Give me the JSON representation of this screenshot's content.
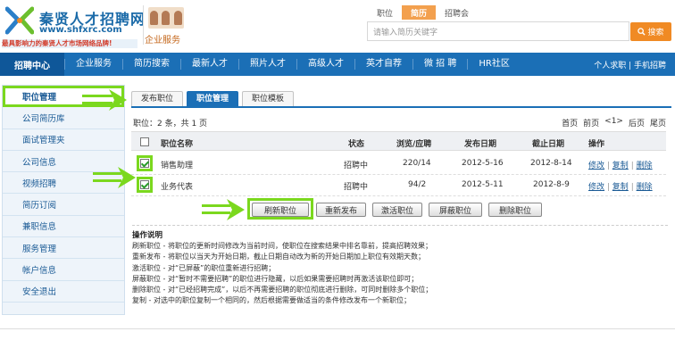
{
  "logo": {
    "title": "秦贤人才招聘网",
    "url": "www.shfxrc.com",
    "slogan": "最具影响力的秦贤人才市场网络品牌!"
  },
  "enterprise": {
    "label": "企业服务"
  },
  "search": {
    "tabs": [
      {
        "label": "职位"
      },
      {
        "label": "简历"
      },
      {
        "label": "招聘会"
      }
    ],
    "active_tab": "简历",
    "placeholder": "请输入简历关键字",
    "button": "搜索"
  },
  "nav": {
    "home": "招聘中心",
    "items": [
      "企业服务",
      "简历搜索",
      "最新人才",
      "照片人才",
      "高级人才",
      "英才自荐",
      "微 招 聘",
      "HR社区"
    ],
    "right": "个人求职 | 手机招聘"
  },
  "sidebar": {
    "items": [
      "职位管理",
      "公司简历库",
      "面试管理夹",
      "公司信息",
      "视频招聘",
      "简历订阅",
      "兼职信息",
      "服务管理",
      "帐户信息",
      "安全退出"
    ],
    "active": "职位管理"
  },
  "tabs": [
    "发布职位",
    "职位管理",
    "职位模板"
  ],
  "active_tab": "职位管理",
  "summary": "职位：2 条，共 1 页",
  "pager": [
    "首页",
    "前页",
    "<1>",
    "后页",
    "尾页"
  ],
  "table": {
    "headers": [
      "职位名称",
      "状态",
      "浏览/应聘",
      "发布日期",
      "截止日期",
      "操作"
    ],
    "rows": [
      {
        "name": "销售助理",
        "status": "招聘中",
        "views": "220/14",
        "publish": "2012-5-16",
        "deadline": "2012-8-14",
        "checked": true
      },
      {
        "name": "业务代表",
        "status": "招聘中",
        "views": "94/2",
        "publish": "2012-5-11",
        "deadline": "2012-8-9",
        "checked": true
      }
    ],
    "actions": [
      "修改",
      "复制",
      "删除"
    ]
  },
  "buttons": [
    "刷新职位",
    "重新发布",
    "激活职位",
    "屏蔽职位",
    "删除职位"
  ],
  "notes": {
    "title": "操作说明",
    "lines": [
      "刷新职位 - 将职位的更新时间修改为当前时间，使职位在搜索结果中排名靠前，提高招聘效果；",
      "重新发布 - 将职位以当天为开始日期，截止日期自动改为新的开始日期加上职位有效期天数；",
      "激活职位 - 对“已屏蔽”的职位重新进行招聘；",
      "屏蔽职位 - 对“暂时不需要招聘”的职位进行隐藏，以后如果需要招聘时再激活该职位即可；",
      "删除职位 - 对“已经招聘完成”，以后不再需要招聘的职位彻底进行删除，可同时删除多个职位；",
      "复制 - 对选中的职位复制一个相同的，然后根据需要做适当的条件修改发布一个新职位；"
    ]
  },
  "colors": {
    "brand_blue": "#1b6fb6",
    "highlight_green": "#7bd81e",
    "accent_orange": "#f08a24"
  }
}
